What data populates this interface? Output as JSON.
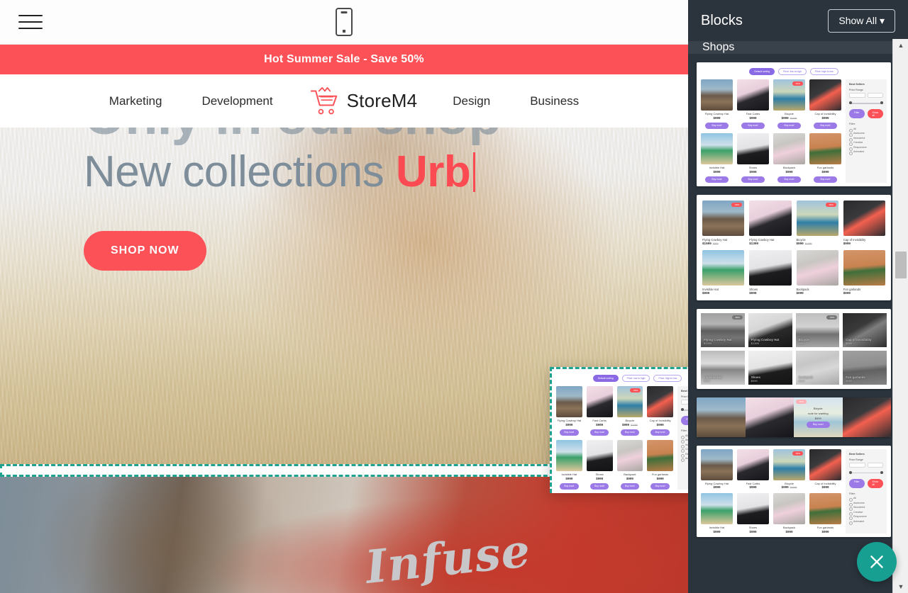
{
  "editor": {
    "menu_icon": "hamburger-icon",
    "viewport_icon": "mobile-phone-icon"
  },
  "site": {
    "promo_banner": "Hot Summer Sale - Save 50%",
    "nav": {
      "left_links": [
        "Marketing",
        "Development"
      ],
      "brand": "StoreM4",
      "brand_icon": "shopping-cart-icon",
      "right_links": [
        "Design",
        "Business"
      ]
    },
    "hero": {
      "headline": "Only in our shop",
      "subhead_static": "New collections ",
      "subhead_typed": "Urb",
      "cta": "SHOP NOW"
    },
    "lower_section": {
      "shirt_text": "Infuse"
    }
  },
  "panel": {
    "title": "Blocks",
    "show_all": "Show All",
    "show_all_caret": "chevron-down-icon",
    "category": "Shops",
    "close_label": "close-icon",
    "scroll_up": "scroll-up-arrow",
    "scroll_down": "scroll-down-arrow"
  },
  "colors": {
    "accent_red": "#fb5157",
    "panel_dark": "#2b343d",
    "teal": "#17a092",
    "drop_zone": "#1fa391",
    "purple_button": "#9b7ae8",
    "hero_text": "#7d8d99"
  },
  "shop_block": {
    "sort_pills": [
      {
        "label": "Default sorting",
        "active": true
      },
      {
        "label": "Price: low to high",
        "active": false
      },
      {
        "label": "Price: high to low",
        "active": false
      }
    ],
    "sidebar": {
      "title": "Best Sellers",
      "price_label": "Price Range",
      "min_placeholder": "min",
      "max_placeholder": "max",
      "filter_button": "Filter",
      "reset_button": "Show all",
      "filters_label": "Filter:",
      "filters": [
        "All",
        "Awesome",
        "Wonderful",
        "Creative",
        "Responsive",
        "Animated"
      ]
    },
    "products": [
      {
        "name": "Flying Cowboy Hat",
        "price": "$999",
        "old_price": "",
        "badge": "",
        "buy": "Buy now!"
      },
      {
        "name": "Fast Carbs",
        "price": "$999",
        "old_price": "",
        "badge": "",
        "buy": "Buy now!"
      },
      {
        "name": "Bicycle",
        "price": "$999",
        "old_price": "$1999",
        "badge": "-50%",
        "buy": "Buy now!"
      },
      {
        "name": "Cap of Invisibility",
        "price": "$999",
        "old_price": "",
        "badge": "",
        "buy": "Buy now!"
      },
      {
        "name": "Invisible Hat",
        "price": "$999",
        "old_price": "",
        "badge": "",
        "buy": "Buy now!"
      },
      {
        "name": "Shoes",
        "price": "$999",
        "old_price": "",
        "badge": "",
        "buy": "Buy now!"
      },
      {
        "name": "Backpack",
        "price": "$999",
        "old_price": "",
        "badge": "",
        "buy": "Buy now!"
      },
      {
        "name": "Fun garlands",
        "price": "$999",
        "old_price": "",
        "badge": "",
        "buy": "Buy now!"
      }
    ],
    "grid_variant_b": [
      {
        "name": "Flying Cowboy Hat",
        "price": "$1599",
        "old_price": "$999",
        "badge": "-50%"
      },
      {
        "name": "Flying Cowboy Hat",
        "price": "$1399",
        "old_price": "",
        "badge": ""
      },
      {
        "name": "Bicycle",
        "price": "$999",
        "old_price": "$1999",
        "badge": "-50%"
      },
      {
        "name": "Cap of Invisibility",
        "price": "$999",
        "old_price": "",
        "badge": ""
      },
      {
        "name": "Invisible Hat",
        "price": "$999",
        "old_price": "",
        "badge": ""
      },
      {
        "name": "Shoes",
        "price": "$999",
        "old_price": "",
        "badge": ""
      },
      {
        "name": "Backpack",
        "price": "$999",
        "old_price": "",
        "badge": ""
      },
      {
        "name": "Fun garlands",
        "price": "$999",
        "old_price": "",
        "badge": ""
      }
    ],
    "hover_card": {
      "name": "Bicycle",
      "tagline": "rode for wanting",
      "price": "$999",
      "buy": "Buy now!"
    }
  }
}
